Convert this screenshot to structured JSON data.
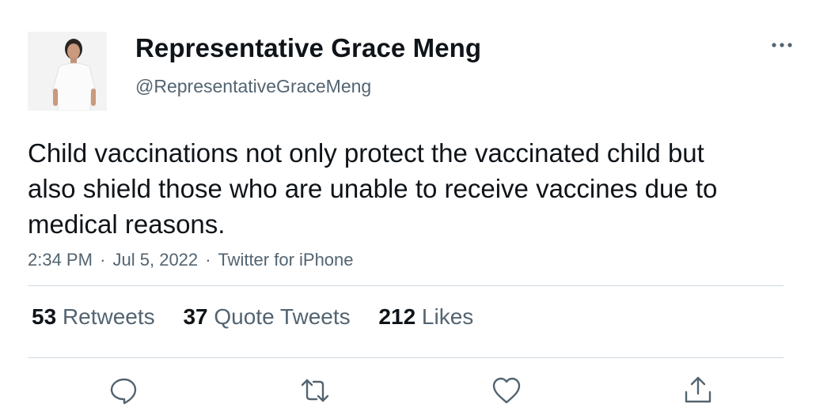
{
  "author": {
    "name": "Representative Grace Meng",
    "handle": "@RepresentativeGraceMeng"
  },
  "tweet": {
    "text": "Child vaccinations not only protect the vaccinated child but also shield those who are unable to receive vaccines due to medical reasons."
  },
  "meta": {
    "time": "2:34 PM",
    "date": "Jul 5, 2022",
    "source": "Twitter for iPhone",
    "separator": "·"
  },
  "stats": {
    "retweets": {
      "count": "53",
      "label": "Retweets"
    },
    "quotes": {
      "count": "37",
      "label": "Quote Tweets"
    },
    "likes": {
      "count": "212",
      "label": "Likes"
    }
  },
  "icons": {
    "more": "more-icon",
    "reply": "reply-icon",
    "retweet": "retweet-icon",
    "like": "heart-icon",
    "share": "share-icon"
  },
  "colors": {
    "text": "#0f1419",
    "secondary": "#536471",
    "divider": "#cfd9de",
    "icon": "#536471"
  }
}
